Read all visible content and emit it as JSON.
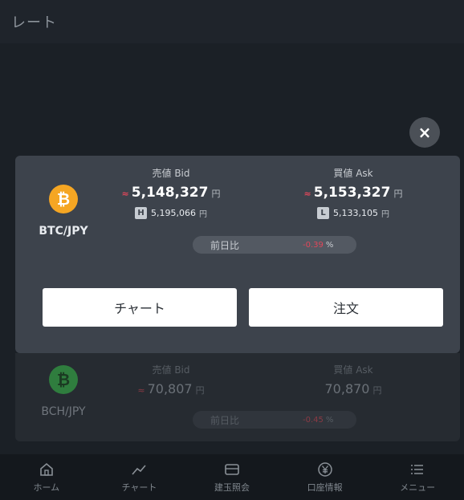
{
  "header": {
    "title": "レート"
  },
  "close": {
    "symbol": "×"
  },
  "rates": [
    {
      "pair": "BTC/JPY",
      "coin_symbol": "₿",
      "coin_color": "#f5a623",
      "bid_label": "売値 Bid",
      "ask_label": "買値 Ask",
      "bid": "5,148,327",
      "ask": "5,153,327",
      "bid_arrow": "≈",
      "ask_arrow": "≈",
      "yen": "円",
      "high_badge": "H",
      "high": "5,195,066",
      "low_badge": "L",
      "low": "5,133,105",
      "change_label": "前日比",
      "change": "-0.39",
      "change_unit": "%",
      "change_color": "#e0475a"
    },
    {
      "pair": "BCH/JPY",
      "coin_symbol": "₿",
      "coin_color": "#2f7d3e",
      "bid_label": "売値 Bid",
      "ask_label": "買値 Ask",
      "bid": "70,807",
      "ask": "70,870",
      "bid_arrow": "≈",
      "yen": "円",
      "change_label": "前日比",
      "change": "-0.45",
      "change_unit": "%"
    }
  ],
  "buttons": {
    "chart": "チャート",
    "order": "注文"
  },
  "tabbar": [
    {
      "label": "ホーム",
      "icon": "home-icon"
    },
    {
      "label": "チャート",
      "icon": "chart-icon"
    },
    {
      "label": "建玉照会",
      "icon": "wallet-icon"
    },
    {
      "label": "口座情報",
      "icon": "yen-icon"
    },
    {
      "label": "メニュー",
      "icon": "menu-icon"
    }
  ]
}
